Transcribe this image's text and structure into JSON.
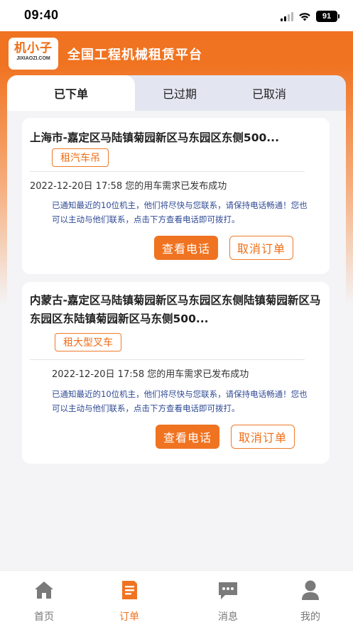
{
  "status_bar": {
    "time": "09:40",
    "battery": "91"
  },
  "header": {
    "logo_cn": "机小子",
    "logo_en": "JIXIAOZI.COM",
    "title": "全国工程机械租赁平台"
  },
  "tabs": [
    {
      "label": "已下单",
      "active": true
    },
    {
      "label": "已过期",
      "active": false
    },
    {
      "label": "已取消",
      "active": false
    }
  ],
  "orders": [
    {
      "title": "上海市-嘉定区马陆镇菊园新区马东园区东侧500...",
      "tag": "租汽车吊",
      "status": "2022-12-20日 17:58 您的用车需求已发布成功",
      "notice": "已通知最近的10位机主，他们将尽快与您联系，请保持电话畅通！您也可以主动与他们联系，点击下方查看电话即可拨打。",
      "view_phone": "查看电话",
      "cancel": "取消订单"
    },
    {
      "title": "内蒙古-嘉定区马陆镇菊园新区马东园区东侧陆镇菊园新区马东园区东陆镇菊园新区马东侧500...",
      "tag": "租大型叉车",
      "status": "2022-12-20日 17:58 您的用车需求已发布成功",
      "notice": "已通知最近的10位机主，他们将尽快与您联系，请保持电话畅通！您也可以主动与他们联系，点击下方查看电话即可拨打。",
      "view_phone": "查看电话",
      "cancel": "取消订单"
    }
  ],
  "tabbar": [
    {
      "label": "首页",
      "icon": "home-icon",
      "active": false
    },
    {
      "label": "订单",
      "icon": "order-icon",
      "active": true
    },
    {
      "label": "消息",
      "icon": "message-icon",
      "active": false
    },
    {
      "label": "我的",
      "icon": "profile-icon",
      "active": false
    }
  ],
  "colors": {
    "accent": "#f07321",
    "notice": "#2f4a94",
    "tab_bg": "#e3e6f1"
  }
}
